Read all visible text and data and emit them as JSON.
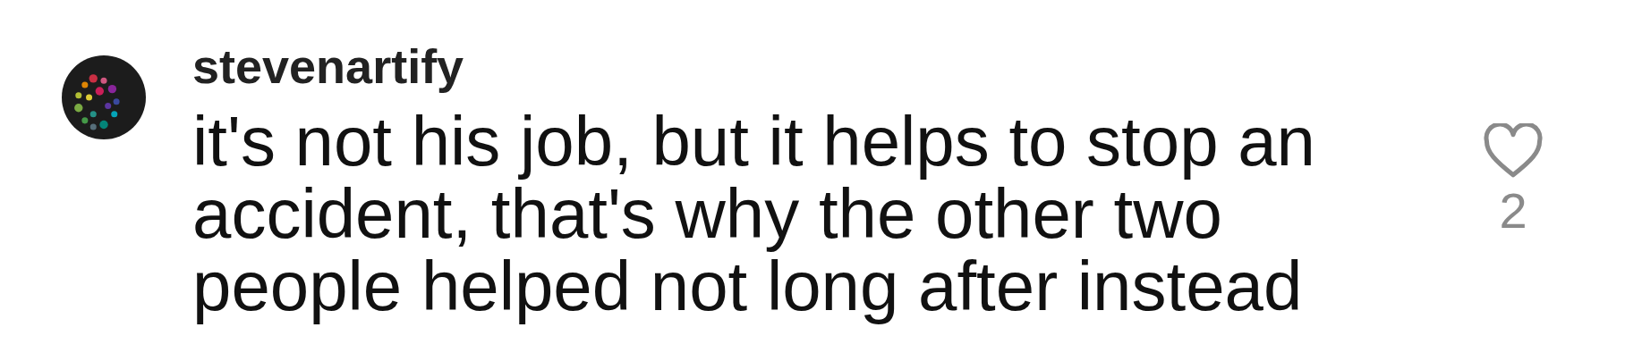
{
  "comment": {
    "username": "stevenartify",
    "text": "it's not his job, but it helps to stop an accident, that's why the other two people helped not long after instead",
    "liked": false,
    "like_count": "2"
  }
}
